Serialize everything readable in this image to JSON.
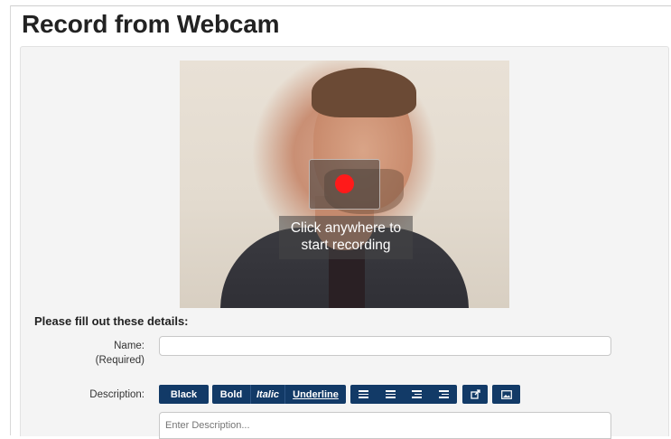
{
  "page": {
    "title": "Record from Webcam"
  },
  "webcam": {
    "record_prompt_line1": "Click anywhere to",
    "record_prompt_line2": "start recording"
  },
  "form": {
    "section_title": "Please fill out these details:",
    "name_label": "Name:",
    "name_required": "(Required)",
    "name_value": "",
    "description_label": "Description:",
    "description_placeholder": "Enter Description..."
  },
  "toolbar": {
    "color_label": "Black",
    "bold_label": "Bold",
    "italic_label": "Italic",
    "underline_label": "Underline",
    "icons": [
      "ordered-list-icon",
      "unordered-list-icon",
      "outdent-icon",
      "indent-icon",
      "insert-link-icon",
      "insert-image-icon"
    ],
    "accent_color": "#123a67",
    "record_color": "#ff1a1a"
  }
}
